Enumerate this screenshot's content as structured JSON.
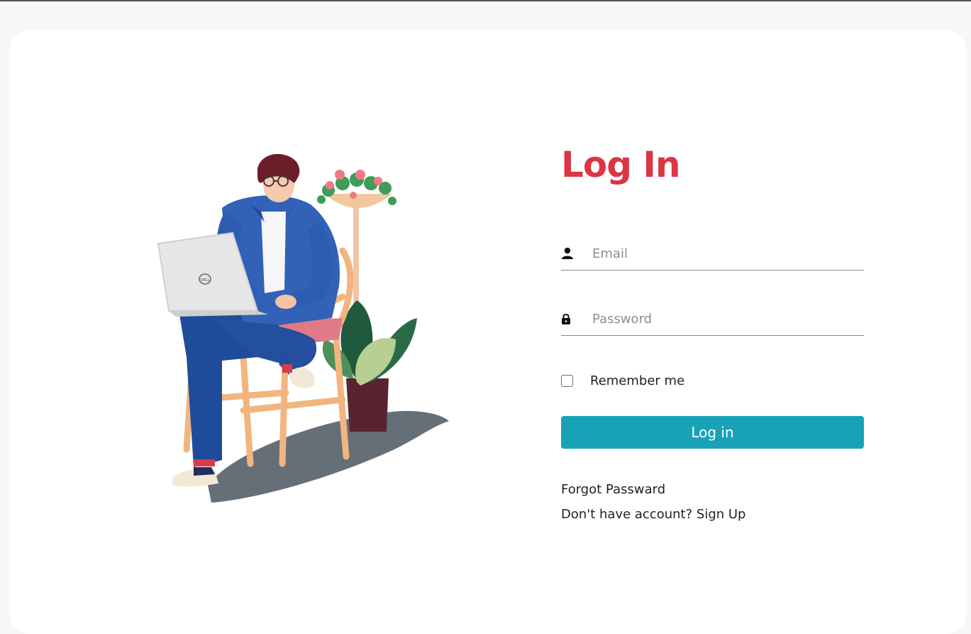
{
  "login": {
    "title": "Log In",
    "email_placeholder": "Email",
    "password_placeholder": "Password",
    "remember_label": "Remember me",
    "submit_label": "Log in",
    "forgot_label": "Forgot Passward",
    "no_account_text": "Don't have account?",
    "signup_label": "Sign Up"
  },
  "illustration": {
    "laptop_logo": "DELL"
  },
  "icons": {
    "email": "user-icon",
    "password": "lock-icon"
  },
  "colors": {
    "title": "#dc3545",
    "button": "#17a2b8",
    "background": "#f7f7f7",
    "card": "#ffffff"
  }
}
